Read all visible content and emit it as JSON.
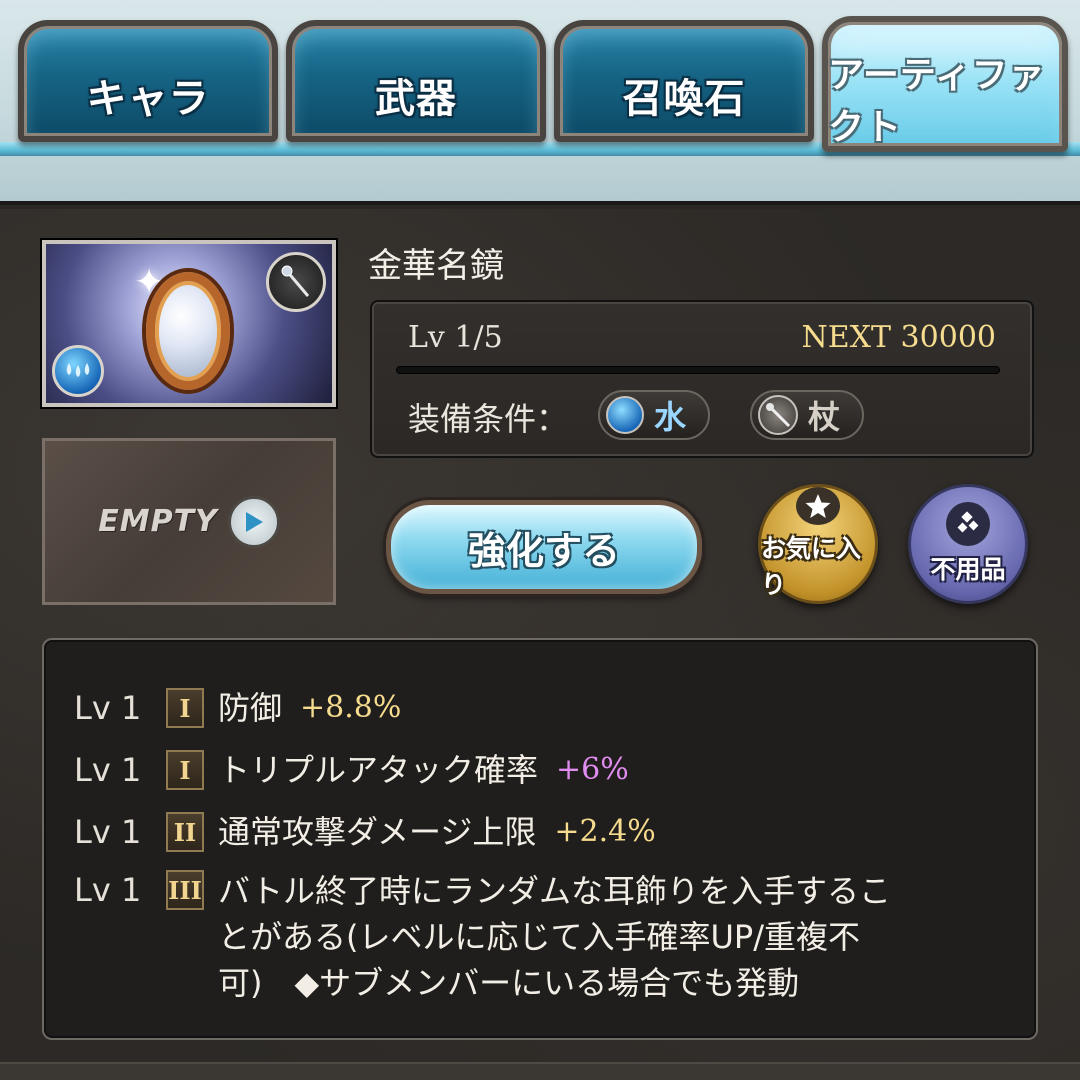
{
  "tabs": [
    {
      "label": "キャラ",
      "active": false
    },
    {
      "label": "武器",
      "active": false
    },
    {
      "label": "召喚石",
      "active": false
    },
    {
      "label": "アーティファクト",
      "active": true
    }
  ],
  "item": {
    "name": "金華名鏡",
    "level": "Lv 1/5",
    "next": "NEXT 30000",
    "weapon_icon": "staff-icon",
    "element_icon": "water-icon"
  },
  "equip_condition": {
    "label": "装備条件：",
    "element": {
      "icon": "water-icon",
      "text": "水"
    },
    "weapon": {
      "icon": "staff-icon",
      "text": "杖"
    }
  },
  "secondary_slot": {
    "label": "EMPTY",
    "icon": "play-icon"
  },
  "buttons": {
    "upgrade": "強化する",
    "favorite": "お気に入り",
    "junk": "不用品"
  },
  "skills": [
    {
      "lv": "Lv 1",
      "tier": "I",
      "name": "防御",
      "value": "+8.8%",
      "value_color": "#f6dc8e"
    },
    {
      "lv": "Lv 1",
      "tier": "I",
      "name": "トリプルアタック確率",
      "value": "+6%",
      "value_color": "#e08cf0"
    },
    {
      "lv": "Lv 1",
      "tier": "II",
      "name": "通常攻撃ダメージ上限",
      "value": "+2.4%",
      "value_color": "#f6dc8e"
    },
    {
      "lv": "Lv 1",
      "tier": "III",
      "desc_lines": [
        "バトル終了時にランダムな耳飾りを入手するこ",
        "とがある(レベルに応じて入手確率UP/重複不",
        "可)　◆サブメンバーにいる場合でも発動"
      ]
    }
  ]
}
